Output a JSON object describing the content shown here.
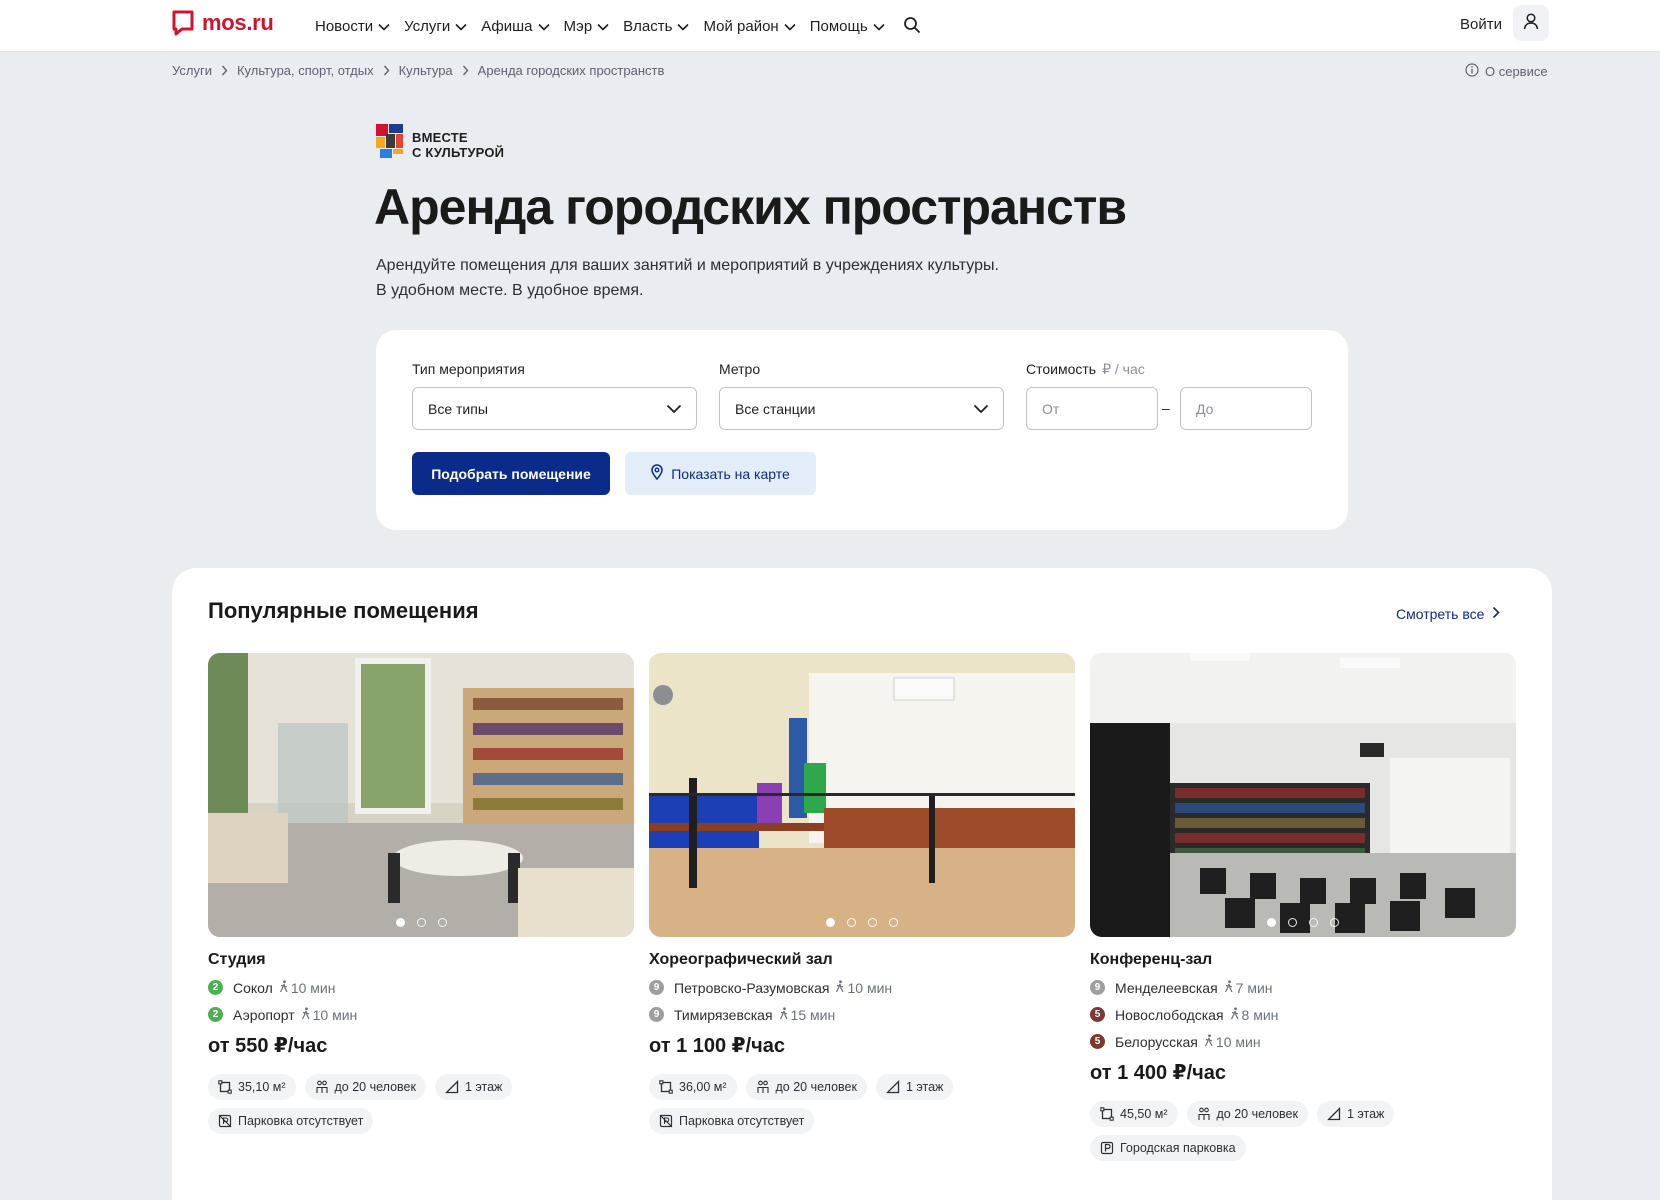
{
  "header": {
    "logo_text": "mos.ru",
    "nav": [
      "Новости",
      "Услуги",
      "Афиша",
      "Мэр",
      "Власть",
      "Мой район",
      "Помощь"
    ],
    "login_label": "Войти"
  },
  "breadcrumb": [
    "Услуги",
    "Культура, спорт, отдых",
    "Культура",
    "Аренда городских пространств"
  ],
  "about_label": "О сервисе",
  "hero": {
    "culture_logo_line1": "ВМЕСТЕ",
    "culture_logo_line2": "С КУЛЬТУРОЙ",
    "title": "Аренда городских пространств",
    "subtitle_line1": "Арендуйте помещения для ваших занятий и мероприятий в учреждениях культуры.",
    "subtitle_line2": "В удобном месте. В удобное время."
  },
  "filter": {
    "event_type_label": "Тип мероприятия",
    "event_type_value": "Все типы",
    "metro_label": "Метро",
    "metro_value": "Все станции",
    "cost_label": "Стоимость",
    "cost_unit": "₽ / час",
    "from_placeholder": "От",
    "to_placeholder": "До",
    "dash": "–",
    "submit_label": "Подобрать помещение",
    "map_label": "Показать на карте"
  },
  "popular": {
    "title": "Популярные помещения",
    "see_all": "Смотреть все",
    "cards": [
      {
        "title": "Студия",
        "metro": [
          {
            "line": "2",
            "color": "#4caf50",
            "station": "Сокол",
            "walk": "10 мин"
          },
          {
            "line": "2",
            "color": "#4caf50",
            "station": "Аэропорт",
            "walk": "10 мин"
          }
        ],
        "price": "от 550 ₽/час",
        "area": "35,10 м²",
        "capacity": "до 20 человек",
        "floor": "1 этаж",
        "parking": "Парковка отсутствует",
        "slides": 3
      },
      {
        "title": "Хореографический зал",
        "metro": [
          {
            "line": "9",
            "color": "#9e9e9e",
            "station": "Петровско-Разумовская",
            "walk": "10 мин"
          },
          {
            "line": "9",
            "color": "#9e9e9e",
            "station": "Тимирязевская",
            "walk": "15 мин"
          }
        ],
        "price": "от 1 100 ₽/час",
        "area": "36,00 м²",
        "capacity": "до 20 человек",
        "floor": "1 этаж",
        "parking": "Парковка отсутствует",
        "slides": 4
      },
      {
        "title": "Конференц-зал",
        "metro": [
          {
            "line": "9",
            "color": "#9e9e9e",
            "station": "Менделеевская",
            "walk": "7 мин"
          },
          {
            "line": "5",
            "color": "#7a3b2e",
            "station": "Новослободская",
            "walk": "8 мин"
          },
          {
            "line": "5",
            "color": "#7a3b2e",
            "station": "Белорусская",
            "walk": "10 мин"
          }
        ],
        "price": "от 1 400 ₽/час",
        "area": "45,50 м²",
        "capacity": "до 20 человек",
        "floor": "1 этаж",
        "parking": "Городская парковка",
        "slides": 4
      }
    ]
  }
}
